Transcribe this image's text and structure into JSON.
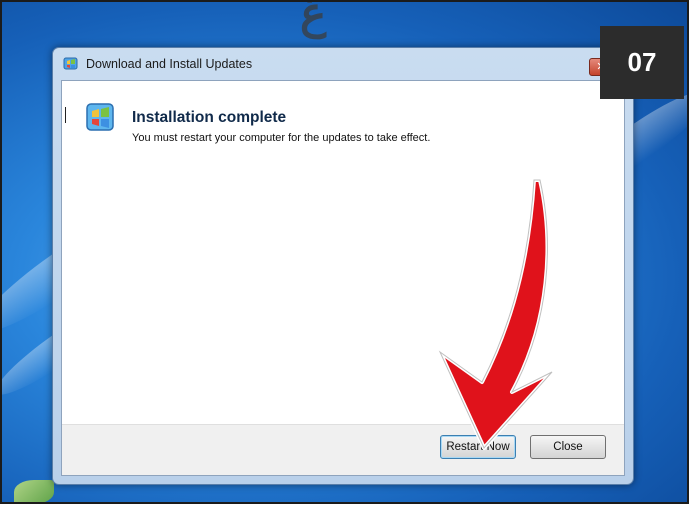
{
  "window": {
    "title": "Download and Install Updates",
    "close_glyph": "✕"
  },
  "content": {
    "heading": "Installation complete",
    "message": "You must restart your computer for the updates to take effect."
  },
  "buttons": {
    "restart_label": "Restart Now",
    "close_label": "Close"
  },
  "step_badge": "07",
  "watermark": "ﻍ",
  "icons": {
    "title": "windows-update-icon",
    "main": "windows-update-icon",
    "annotation": "red-arrow-icon"
  },
  "colors": {
    "badge_bg": "#2c2c2c",
    "arrow": "#e0121b",
    "desktop": "#2a86dc"
  }
}
